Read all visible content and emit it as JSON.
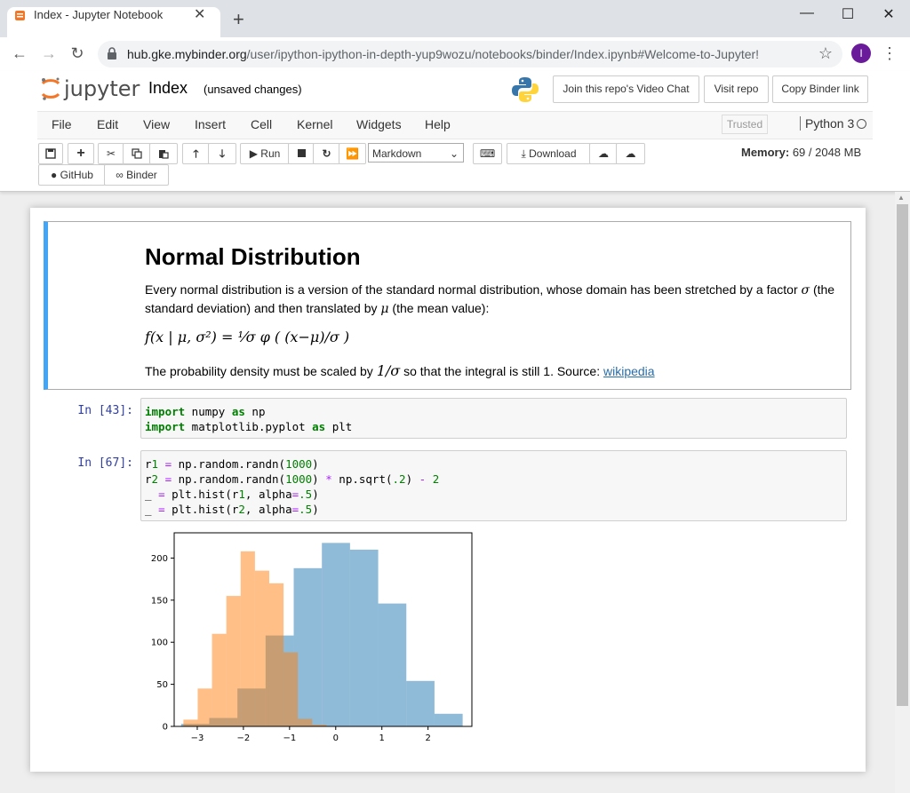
{
  "browser": {
    "tab_title": "Index - Jupyter Notebook",
    "tab_close": "✕",
    "new_tab": "+",
    "url_host": "hub.gke.mybinder.org",
    "url_path": "/user/ipython-ipython-in-depth-yup9wozu/notebooks/binder/Index.ipynb#Welcome-to-Jupyter!",
    "avatar_letter": "I",
    "window": {
      "minimize": "—",
      "maximize": "☐",
      "close": "✕"
    },
    "nav": {
      "back": "←",
      "forward": "→",
      "reload": "↻",
      "star": "☆",
      "menu": "⋮",
      "lock": "🔒"
    }
  },
  "jupyter": {
    "logo_text": "jupyter",
    "notebook_name": "Index",
    "save_status": "(unsaved changes)",
    "header_buttons": [
      "Join this repo's Video Chat",
      "Visit repo",
      "Copy Binder link"
    ],
    "menu": [
      "File",
      "Edit",
      "View",
      "Insert",
      "Cell",
      "Kernel",
      "Widgets",
      "Help"
    ],
    "trusted": "Trusted",
    "kernel": "Python 3",
    "toolbar": {
      "run_label": "Run",
      "cell_type": "Markdown",
      "download_label": "Download",
      "github_label": "GitHub",
      "binder_label": "Binder"
    },
    "memory_label": "Memory:",
    "memory_value": "69 / 2048 MB"
  },
  "cells": {
    "markdown": {
      "title": "Normal Distribution",
      "para1a": "Every normal distribution is a version of the standard normal distribution, whose domain has been stretched by a factor ",
      "sigma": "σ",
      "para1b": " (the standard deviation) and then translated by ",
      "mu": "μ",
      "para1c": " (the mean value):",
      "formula": "f(x | μ, σ²) = ¹⁄σ φ ( (x−μ)/σ )",
      "para2a": "The probability density must be scaled by ",
      "scale": "1/σ",
      "para2b": " so that the integral is still 1. Source: ",
      "link": "wikipedia"
    },
    "code1": {
      "prompt": "In [43]:",
      "line1_kw1": "import",
      "line1_mod": " numpy ",
      "line1_kw2": "as",
      "line1_alias": " np",
      "line2_kw1": "import",
      "line2_mod": " matplotlib.pyplot ",
      "line2_kw2": "as",
      "line2_alias": " plt"
    },
    "code2": {
      "prompt": "In [67]:",
      "lines": [
        "r1 = np.random.randn(1000)",
        "r2 = np.random.randn(1000) * np.sqrt(.2) - 2",
        "_ = plt.hist(r1, alpha=.5)",
        "_ = plt.hist(r2, alpha=.5)"
      ]
    }
  },
  "colors": {
    "blue_series": "#1f77b4",
    "orange_series": "#ff7f0e",
    "md_border": "#42a5f5",
    "prompt": "#303f9f"
  },
  "chart_data": {
    "type": "bar",
    "title": "",
    "xlabel": "",
    "ylabel": "",
    "xlim": [
      -3.5,
      2.95
    ],
    "ylim": [
      0,
      230
    ],
    "xticks": [
      -3,
      -2,
      -1,
      0,
      1,
      2
    ],
    "xtick_labels": [
      "−3",
      "−2",
      "−1",
      "0",
      "1",
      "2"
    ],
    "yticks": [
      0,
      50,
      100,
      150,
      200
    ],
    "ytick_labels": [
      "0",
      "50",
      "100",
      "150",
      "200"
    ],
    "alpha": 0.5,
    "series": [
      {
        "color": "#1f77b4",
        "bin_edges": [
          -3.35,
          -2.74,
          -2.13,
          -1.52,
          -0.91,
          -0.3,
          0.31,
          0.92,
          1.53,
          2.14,
          2.75
        ],
        "counts": [
          3,
          10,
          45,
          108,
          188,
          218,
          210,
          146,
          54,
          15
        ]
      },
      {
        "color": "#ff7f0e",
        "bin_edges": [
          -3.3,
          -2.99,
          -2.68,
          -2.37,
          -2.06,
          -1.75,
          -1.44,
          -1.13,
          -0.82,
          -0.51,
          -0.2
        ],
        "counts": [
          8,
          45,
          110,
          155,
          208,
          185,
          170,
          88,
          9,
          2
        ]
      }
    ]
  }
}
